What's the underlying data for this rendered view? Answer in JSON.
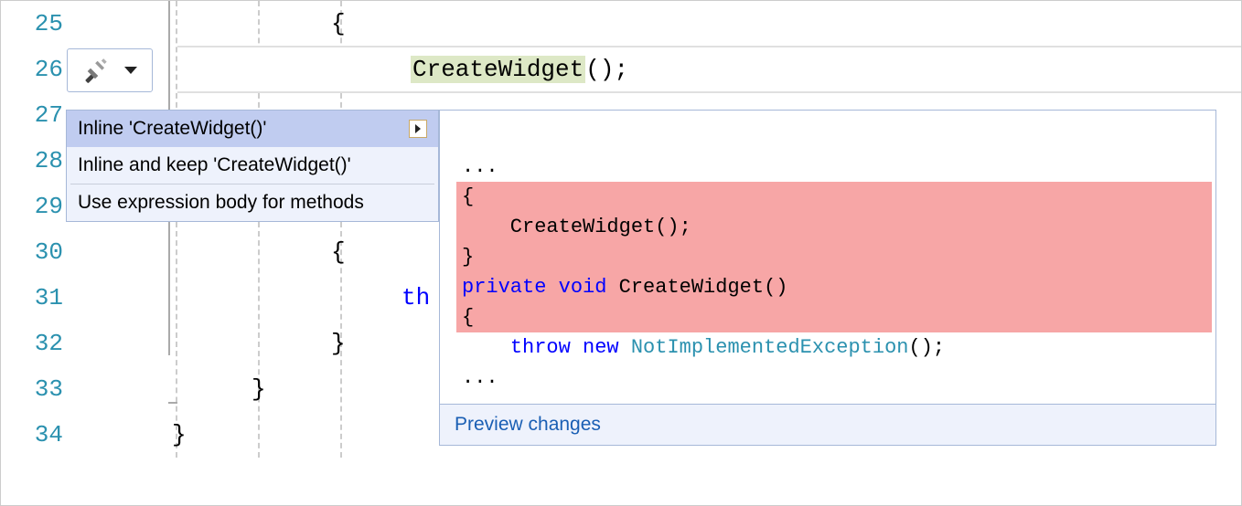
{
  "gutter": {
    "start": 25,
    "end": 34
  },
  "code": {
    "line25": "{",
    "line26_hl": "CreateWidget",
    "line26_rest": "();",
    "line30": "{",
    "line31_kw": "th",
    "line32": "}",
    "line33": "}",
    "line34": "}"
  },
  "lightbulb": {
    "tooltip": "Quick Actions"
  },
  "menu": {
    "items": [
      {
        "label": "Inline 'CreateWidget()'",
        "selected": true,
        "hasSubmenu": true
      },
      {
        "label": "Inline and keep 'CreateWidget()'",
        "selected": false,
        "hasSubmenu": false
      }
    ],
    "items2": [
      {
        "label": "Use expression body for methods",
        "selected": false,
        "hasSubmenu": false
      }
    ]
  },
  "preview": {
    "l1": "...",
    "l2": "{",
    "l3": "    CreateWidget();",
    "l4": "}",
    "l5": "",
    "l6_kw1": "private",
    "l6_kw2": "void",
    "l6_rest": " CreateWidget()",
    "l7": "{",
    "l8_kw1": "throw",
    "l8_kw2": "new",
    "l8_type": "NotImplementedException",
    "l8_rest": "();",
    "l9": "...",
    "footer": "Preview changes"
  }
}
